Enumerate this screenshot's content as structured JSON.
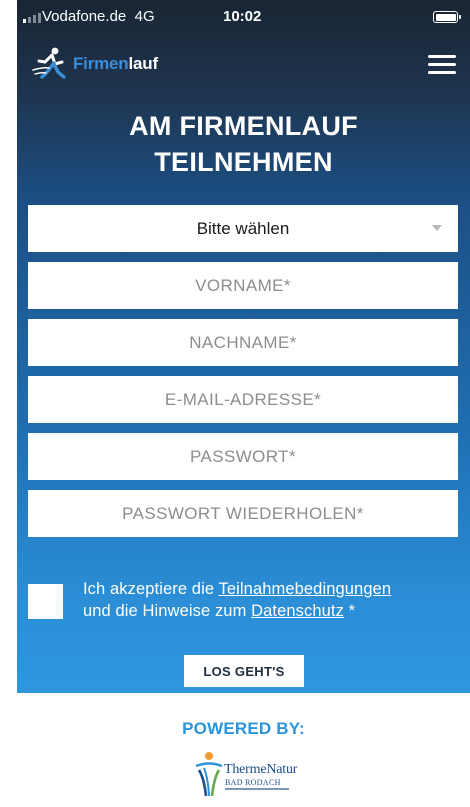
{
  "status_bar": {
    "carrier": "Vodafone.de",
    "network": "4G",
    "time": "10:02"
  },
  "header": {
    "logo_prefix": "Firmen",
    "logo_suffix": "lauf",
    "menu_icon": "hamburger-menu-icon"
  },
  "page": {
    "title_line1": "AM FIRMENLAUF",
    "title_line2": "TEILNEHMEN"
  },
  "form": {
    "select_value": "Bitte wählen",
    "first_name_placeholder": "VORNAME*",
    "last_name_placeholder": "NACHNAME*",
    "email_placeholder": "E-MAIL-ADRESSE*",
    "password_placeholder": "PASSWORT*",
    "password_repeat_placeholder": "PASSWORT WIEDERHOLEN*",
    "consent_prefix": "Ich akzeptiere die ",
    "consent_terms_link": "Teilnahmebedingungen",
    "consent_middle": "und die Hinweise zum ",
    "consent_privacy_link": "Datenschutz",
    "consent_suffix": " *",
    "submit_label": "LOS GEHT'S"
  },
  "footer": {
    "powered_by": "POWERED BY:",
    "sponsor_name": "ThermeNatur",
    "sponsor_location": "BAD RODACH"
  },
  "colors": {
    "header_dark": "#1a2533",
    "gradient_mid": "#1c4f84",
    "gradient_bottom": "#2d97de",
    "accent_blue": "#2b95da",
    "logo_blue": "#3b8fd8",
    "button_text": "#1f2d3d"
  }
}
